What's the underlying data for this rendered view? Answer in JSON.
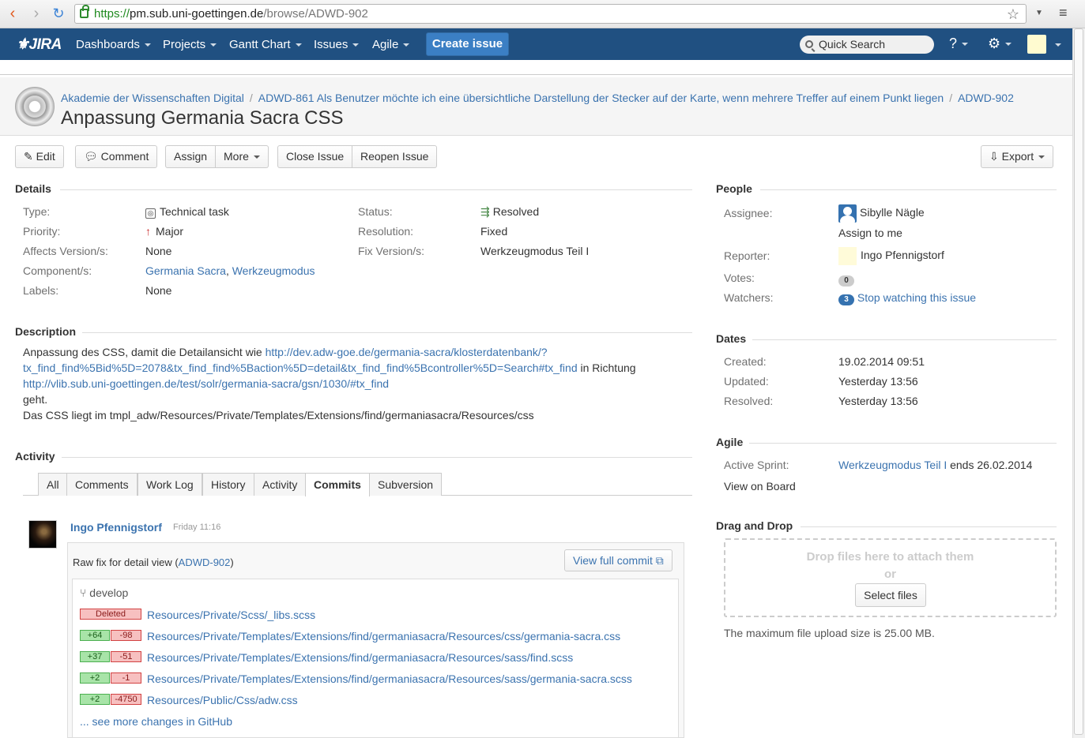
{
  "browser": {
    "url_https": "https://",
    "url_host": "pm.sub.uni-goettingen.de",
    "url_path": "/browse/ADWD-902"
  },
  "nav": {
    "logo": "JIRA",
    "items": [
      "Dashboards",
      "Projects",
      "Gantt Chart",
      "Issues",
      "Agile"
    ],
    "create": "Create issue",
    "search_placeholder": "Quick Search"
  },
  "header": {
    "crumb_project": "Akademie der Wissenschaften Digital",
    "crumb_parent": "ADWD-861 Als Benutzer möchte ich eine übersichtliche Darstellung der Stecker auf der Karte, wenn mehrere Treffer auf einem Punkt liegen",
    "crumb_issue": "ADWD-902",
    "title": "Anpassung Germania Sacra CSS"
  },
  "toolbar": {
    "edit": "Edit",
    "comment": "Comment",
    "assign": "Assign",
    "more": "More",
    "close_issue": "Close Issue",
    "reopen_issue": "Reopen Issue",
    "export": "Export"
  },
  "details": {
    "heading": "Details",
    "type_label": "Type:",
    "type": "Technical task",
    "priority_label": "Priority:",
    "priority": "Major",
    "affects_label": "Affects Version/s:",
    "affects": "None",
    "components_label": "Component/s:",
    "component1": "Germania Sacra",
    "component2": "Werkzeugmodus",
    "labels_label": "Labels:",
    "labels": "None",
    "status_label": "Status:",
    "status": "Resolved",
    "resolution_label": "Resolution:",
    "resolution": "Fixed",
    "fix_label": "Fix Version/s:",
    "fix": "Werkzeugmodus Teil I"
  },
  "description": {
    "heading": "Description",
    "line1_text": "Anpassung des CSS, damit die Detailansicht wie ",
    "line1_link": "http://dev.adw-goe.de/germania-sacra/klosterdatenbank/?",
    "line2_link": "tx_find_find%5Bid%5D=2078&tx_find_find%5Baction%5D=detail&tx_find_find%5Bcontroller%5D=Search#tx_find",
    "line2_text": " in Richtung",
    "line3_link": "http://vlib.sub.uni-goettingen.de/test/solr/germania-sacra/gsn/1030/#tx_find",
    "line4": "geht.",
    "line5": "Das CSS liegt im tmpl_adw/Resources/Private/Templates/Extensions/find/germaniasacra/Resources/css"
  },
  "activity": {
    "heading": "Activity",
    "tabs": [
      "All",
      "Comments",
      "Work Log",
      "History",
      "Activity",
      "Commits",
      "Subversion"
    ],
    "commit_author": "Ingo Pfennigstorf",
    "commit_time": "Friday 11:16",
    "commit_msg": "Raw fix for detail view (",
    "commit_issue": "ADWD-902",
    "commit_msg_end": ")",
    "view_full": "View full commit",
    "branch": "develop",
    "files": [
      {
        "plus": "",
        "minus": "",
        "deleted": "Deleted",
        "path": "Resources/Private/Scss/_libs.scss"
      },
      {
        "plus": "+64",
        "minus": "-98",
        "path": "Resources/Private/Templates/Extensions/find/germaniasacra/Resources/css/germania-sacra.css"
      },
      {
        "plus": "+37",
        "minus": "-51",
        "path": "Resources/Private/Templates/Extensions/find/germaniasacra/Resources/sass/find.scss"
      },
      {
        "plus": "+2",
        "minus": "-1",
        "path": "Resources/Private/Templates/Extensions/find/germaniasacra/Resources/sass/germania-sacra.scss"
      },
      {
        "plus": "+2",
        "minus": "-4750",
        "path": "Resources/Public/Css/adw.css"
      }
    ],
    "see_more": "... see more changes in GitHub"
  },
  "people": {
    "heading": "People",
    "assignee_label": "Assignee:",
    "assignee": "Sibylle Nägle",
    "assign_to_me": "Assign to me",
    "reporter_label": "Reporter:",
    "reporter": "Ingo Pfennigstorf",
    "votes_label": "Votes:",
    "votes": "0",
    "watchers_label": "Watchers:",
    "watchers": "3",
    "stop_watching": "Stop watching this issue"
  },
  "dates": {
    "heading": "Dates",
    "created_label": "Created:",
    "created": "19.02.2014 09:51",
    "updated_label": "Updated:",
    "updated": "Yesterday 13:56",
    "resolved_label": "Resolved:",
    "resolved": "Yesterday 13:56"
  },
  "agile": {
    "heading": "Agile",
    "sprint_label": "Active Sprint:",
    "sprint": "Werkzeugmodus Teil I",
    "sprint_end": " ends 26.02.2014",
    "view_board": "View on Board"
  },
  "dnd": {
    "heading": "Drag and Drop",
    "drop_text": "Drop files here to attach them",
    "or": "or",
    "select": "Select files",
    "max_size": "The maximum file upload size is 25.00 MB."
  }
}
